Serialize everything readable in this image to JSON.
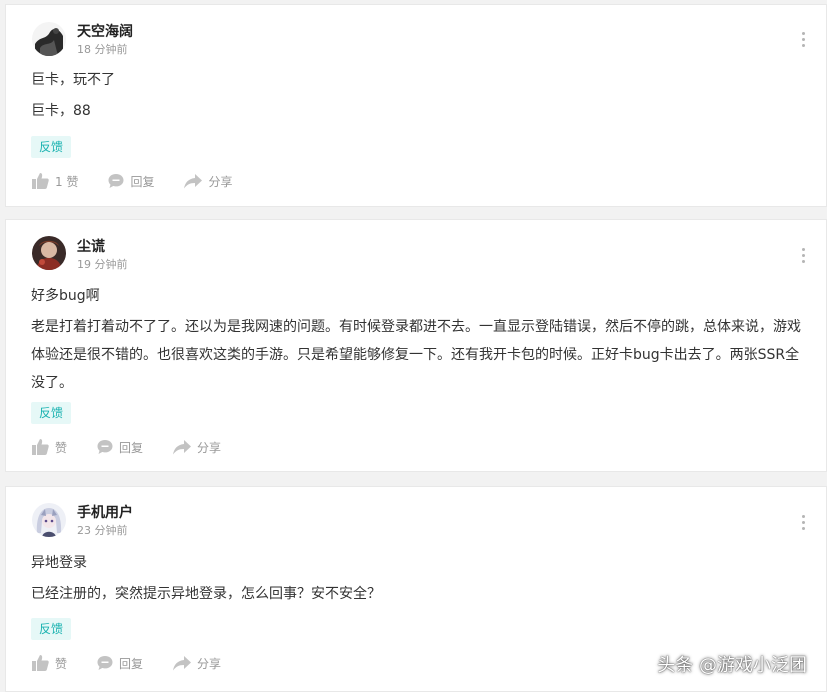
{
  "posts": [
    {
      "username": "天空海阔",
      "time": "18 分钟前",
      "title": "巨卡，玩不了",
      "body": "巨卡，88",
      "tag": "反馈",
      "like_label": "1 赞",
      "reply_label": "回复",
      "share_label": "分享",
      "avatar_icon": "ink-painting-avatar"
    },
    {
      "username": "尘谎",
      "time": "19 分钟前",
      "title": "好多bug啊",
      "body": "老是打着打着动不了了。还以为是我网速的问题。有时候登录都进不去。一直显示登陆错误，然后不停的跳，总体来说，游戏体验还是很不错的。也很喜欢这类的手游。只是希望能够修复一下。还有我开卡包的时候。正好卡bug卡出去了。两张SSR全没了。",
      "tag": "反馈",
      "like_label": "赞",
      "reply_label": "回复",
      "share_label": "分享",
      "avatar_icon": "character-avatar"
    },
    {
      "username": "手机用户",
      "time": "23 分钟前",
      "title": "异地登录",
      "body": "已经注册的，突然提示异地登录，怎么回事？安不安全？",
      "tag": "反馈",
      "like_label": "赞",
      "reply_label": "回复",
      "share_label": "分享",
      "avatar_icon": "anime-girl-avatar"
    }
  ],
  "watermark": "头条 @游戏小泛团",
  "colors": {
    "tag_text": "#19b2b0",
    "tag_bg": "#e6f8f7",
    "muted": "#999999",
    "page_bg": "#f2f2f2"
  }
}
